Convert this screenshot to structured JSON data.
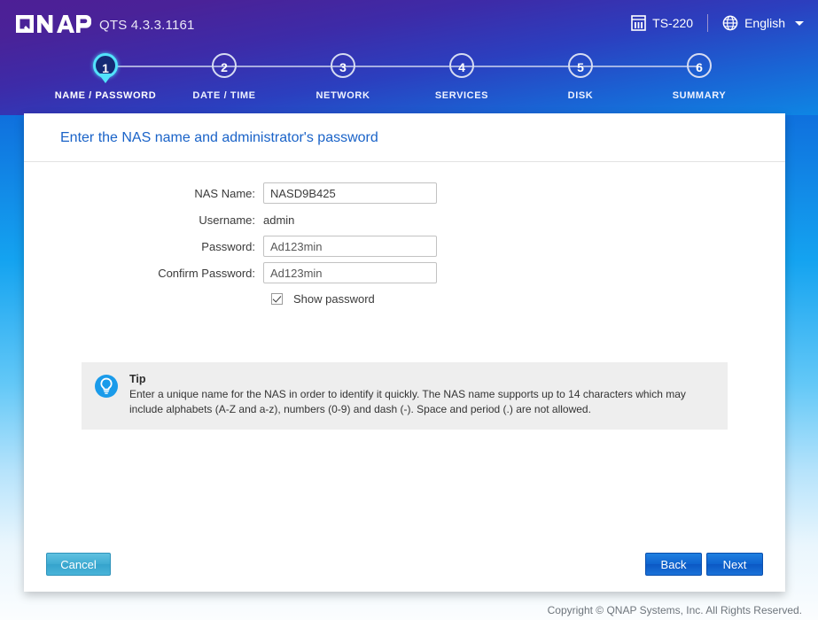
{
  "header": {
    "logo_text": "QNAP",
    "qts_version": "QTS 4.3.3.1161",
    "nas_model": "TS-220",
    "nas_icon": "nas-enclosure-icon",
    "language": "English",
    "language_icon": "globe-icon",
    "caret_icon": "chevron-down-icon"
  },
  "stepper": {
    "active_step": 1,
    "steps": [
      {
        "number": "1",
        "label": "NAME / PASSWORD"
      },
      {
        "number": "2",
        "label": "DATE / TIME"
      },
      {
        "number": "3",
        "label": "NETWORK"
      },
      {
        "number": "4",
        "label": "SERVICES"
      },
      {
        "number": "5",
        "label": "DISK"
      },
      {
        "number": "6",
        "label": "SUMMARY"
      }
    ]
  },
  "panel": {
    "title": "Enter the NAS name and administrator's password",
    "form": {
      "nas_name_label": "NAS Name:",
      "nas_name_value": "NASD9B425",
      "username_label": "Username:",
      "username_value": "admin",
      "password_label": "Password:",
      "password_value": "Ad123min",
      "confirm_password_label": "Confirm Password:",
      "confirm_password_value": "Ad123min",
      "show_password_label": "Show password",
      "show_password_checked": true
    },
    "tip": {
      "icon": "lightbulb-icon",
      "title": "Tip",
      "body": "Enter a unique name for the NAS in order to identify it quickly. The NAS name supports up to 14 characters which may include alphabets (A-Z and a-z), numbers (0-9) and dash (-). Space and period (.) are not allowed."
    },
    "buttons": {
      "cancel": "Cancel",
      "back": "Back",
      "next": "Next"
    }
  },
  "footer": {
    "copyright": "Copyright © QNAP Systems, Inc. All Rights Reserved."
  },
  "colors": {
    "header_purple": "#4d1f96",
    "header_blue": "#0e86e4",
    "accent_cyan": "#52e3fb",
    "title_blue": "#1a63c8",
    "primary_button": "#0f64cf",
    "cancel_button": "#3fabd2",
    "tip_background": "#eeeeee"
  }
}
